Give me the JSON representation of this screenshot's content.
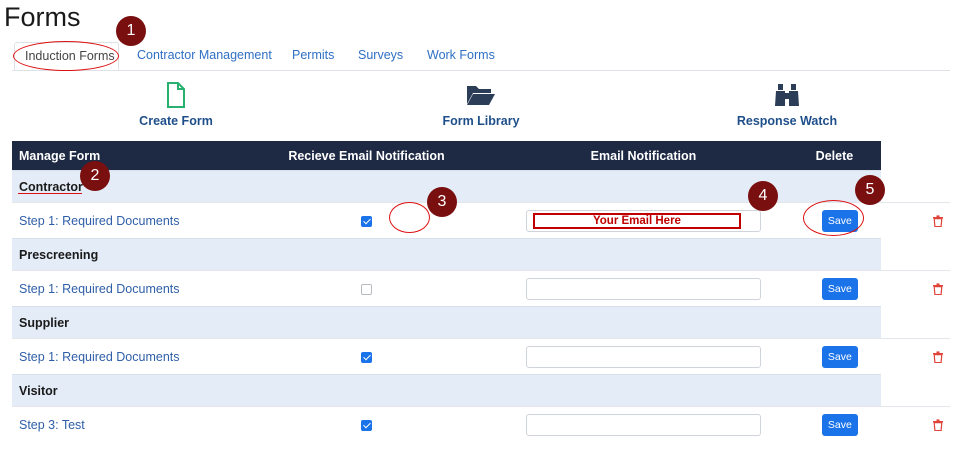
{
  "page": {
    "title": "Forms"
  },
  "tabs": [
    {
      "label": "Induction Forms",
      "active": true
    },
    {
      "label": "Contractor Management"
    },
    {
      "label": "Permits"
    },
    {
      "label": "Surveys"
    },
    {
      "label": "Work Forms"
    }
  ],
  "toolbar": {
    "create": {
      "label": "Create Form",
      "icon": "file-icon"
    },
    "library": {
      "label": "Form Library",
      "icon": "folder-open-icon"
    },
    "watch": {
      "label": "Response Watch",
      "icon": "binoculars-icon"
    }
  },
  "table": {
    "headers": {
      "manage": "Manage Form",
      "receive": "Recieve Email Notification",
      "email": "Email Notification",
      "delete": "Delete"
    },
    "save_label": "Save",
    "groups": [
      {
        "name": "Contractor",
        "rows": [
          {
            "form": "Step 1: Required Documents",
            "notify": true,
            "email_placeholder": "Your Email Here"
          }
        ]
      },
      {
        "name": "Prescreening",
        "rows": [
          {
            "form": "Step 1: Required Documents",
            "notify": false,
            "email_placeholder": ""
          }
        ]
      },
      {
        "name": "Supplier",
        "rows": [
          {
            "form": "Step 1: Required Documents",
            "notify": true,
            "email_placeholder": ""
          }
        ]
      },
      {
        "name": "Visitor",
        "rows": [
          {
            "form": "Step 3: Test",
            "notify": true,
            "email_placeholder": ""
          }
        ]
      }
    ]
  },
  "callouts": [
    "1",
    "2",
    "3",
    "4",
    "5"
  ],
  "colors": {
    "header_bg": "#1e2a44",
    "accent": "#1a73e8",
    "callout": "#7a0f0f",
    "highlight": "#c00000",
    "trash": "#e0433a"
  }
}
